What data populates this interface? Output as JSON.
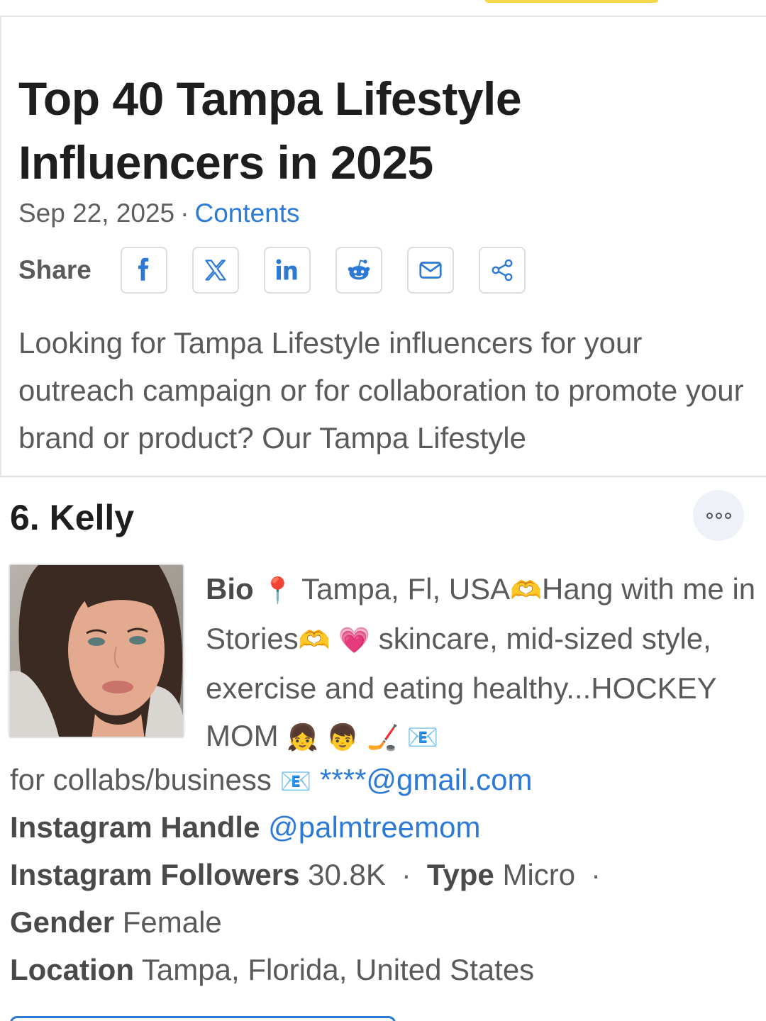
{
  "article": {
    "title": "Top 40 Tampa Lifestyle Influencers in 2025",
    "date": "Sep 22, 2025",
    "separator": "·",
    "contents_link": "Contents",
    "share_label": "Share",
    "share_buttons": [
      "facebook-icon",
      "x-icon",
      "linkedin-icon",
      "reddit-icon",
      "mail-icon",
      "share-icon"
    ],
    "intro": "Looking for Tampa Lifestyle influencers for your outreach campaign or for collaboration to promote your brand or product? Our Tampa Lifestyle"
  },
  "influencer": {
    "title": "6. Kelly",
    "bio_label": "Bio",
    "bio_part1": "Tampa, Fl, USA",
    "bio_part2": "Hang with me in Stories",
    "bio_part3": "skincare, mid-sized style, exercise and eating healthy...HOCKEY MOM",
    "bio_part4": "for collabs/business",
    "email": "****@gmail.com",
    "emojis": {
      "pin": "📍",
      "heart_hands": "🫶",
      "pink_heart": "💗",
      "girl": "👧",
      "boy": "👦",
      "hockey": "🏒",
      "envelope": "📧"
    },
    "handle_label": "Instagram Handle",
    "handle": "@palmtreemom",
    "followers_label": "Instagram Followers",
    "followers": "30.8K",
    "type_label": "Type",
    "type": "Micro",
    "gender_label": "Gender",
    "gender": "Female",
    "location_label": "Location",
    "location": "Tampa, Florida, United States",
    "separator": "·"
  },
  "colors": {
    "link": "#2d7ad6",
    "accent_yellow": "#f7d64a"
  }
}
